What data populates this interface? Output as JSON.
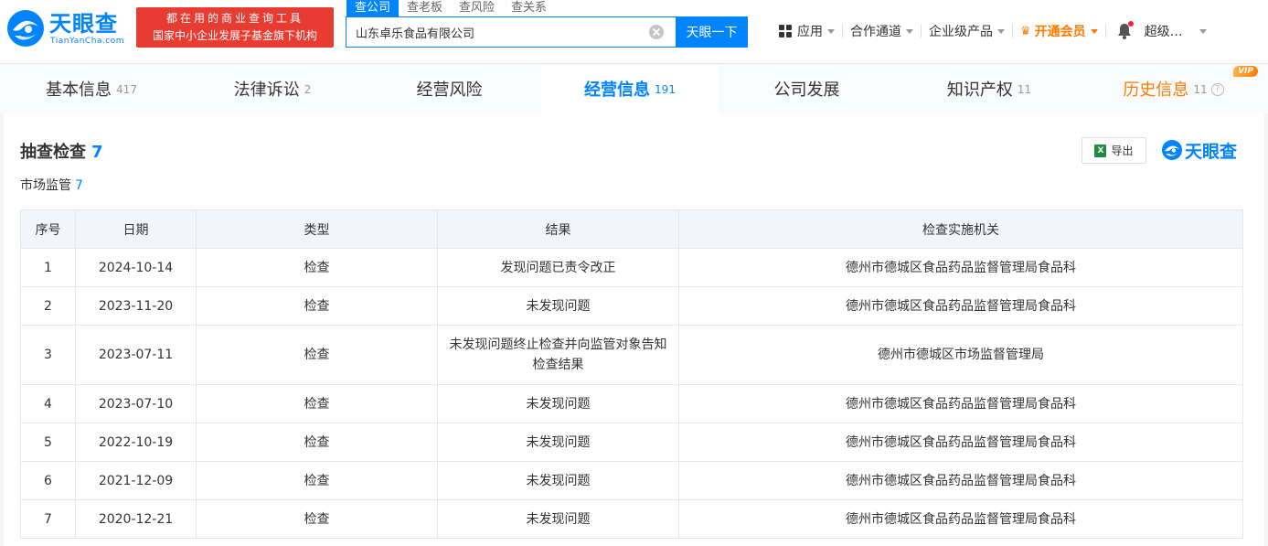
{
  "header": {
    "logo_cn": "天眼查",
    "logo_en": "TianYanCha.com",
    "promo_line1": "都在用的商业查询工具",
    "promo_line2": "国家中小企业发展子基金旗下机构",
    "search_tabs": [
      "查公司",
      "查老板",
      "查风险",
      "查关系"
    ],
    "search_value": "山东卓乐食品有限公司",
    "search_button": "天眼一下",
    "nav": {
      "apps": "应用",
      "channel": "合作通道",
      "enterprise": "企业级产品",
      "vip": "开通会员",
      "user": "超级…"
    }
  },
  "tabs": [
    {
      "label": "基本信息",
      "count": "417"
    },
    {
      "label": "法律诉讼",
      "count": "2"
    },
    {
      "label": "经营风险",
      "count": ""
    },
    {
      "label": "经营信息",
      "count": "191"
    },
    {
      "label": "公司发展",
      "count": ""
    },
    {
      "label": "知识产权",
      "count": "11"
    },
    {
      "label": "历史信息",
      "count": "11",
      "badge": "VIP"
    }
  ],
  "section": {
    "title": "抽查检查",
    "count": "7",
    "sub_title": "市场监管",
    "sub_count": "7",
    "export_label": "导出",
    "brand": "天眼查"
  },
  "table": {
    "headers": [
      "序号",
      "日期",
      "类型",
      "结果",
      "检查实施机关"
    ],
    "rows": [
      [
        "1",
        "2024-10-14",
        "检查",
        "发现问题已责令改正",
        "德州市德城区食品药品监督管理局食品科"
      ],
      [
        "2",
        "2023-11-20",
        "检查",
        "未发现问题",
        "德州市德城区食品药品监督管理局食品科"
      ],
      [
        "3",
        "2023-07-11",
        "检查",
        "未发现问题终止检查并向监管对象告知检查结果",
        "德州市德城区市场监督管理局"
      ],
      [
        "4",
        "2023-07-10",
        "检查",
        "未发现问题",
        "德州市德城区食品药品监督管理局食品科"
      ],
      [
        "5",
        "2022-10-19",
        "检查",
        "未发现问题",
        "德州市德城区食品药品监督管理局食品科"
      ],
      [
        "6",
        "2021-12-09",
        "检查",
        "未发现问题",
        "德州市德城区食品药品监督管理局食品科"
      ],
      [
        "7",
        "2020-12-21",
        "检查",
        "未发现问题",
        "德州市德城区食品药品监督管理局食品科"
      ]
    ]
  },
  "colors": {
    "brand_blue": "#0084ff",
    "promo_red": "#e83c33",
    "vip_orange": "#ff7a00",
    "header_bg": "#f2f6fc"
  }
}
